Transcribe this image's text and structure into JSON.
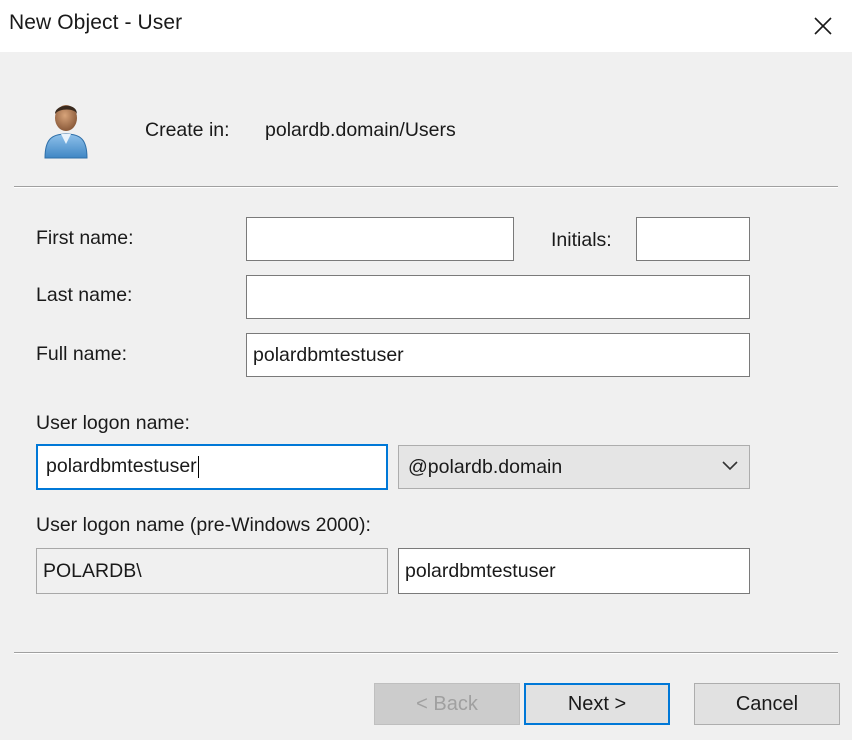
{
  "window": {
    "title": "New Object - User",
    "close_icon": "close-icon"
  },
  "header": {
    "icon": "user-icon",
    "create_in_label": "Create in:",
    "create_in_path": "polardb.domain/Users"
  },
  "form": {
    "first_name": {
      "label": "First name:",
      "value": ""
    },
    "initials": {
      "label": "Initials:",
      "value": ""
    },
    "last_name": {
      "label": "Last name:",
      "value": ""
    },
    "full_name": {
      "label": "Full name:",
      "value": "polardbmtestuser"
    },
    "logon_name": {
      "label": "User logon name:",
      "value": "polardbmtestuser",
      "domain_selected": "@polardb.domain",
      "domain_icon": "chevron-down-icon"
    },
    "pre2000": {
      "label": "User logon name (pre-Windows 2000):",
      "domain_prefix": "POLARDB\\",
      "value": "polardbmtestuser"
    }
  },
  "buttons": {
    "back": "< Back",
    "next": "Next >",
    "cancel": "Cancel"
  },
  "colors": {
    "dialog_bg": "#f0f0f0",
    "titlebar_bg": "#ffffff",
    "focus_accent": "#0078d7",
    "input_border": "#7a7a7a",
    "button_bg": "#e1e1e1",
    "disabled_button_bg": "#cccccc"
  }
}
